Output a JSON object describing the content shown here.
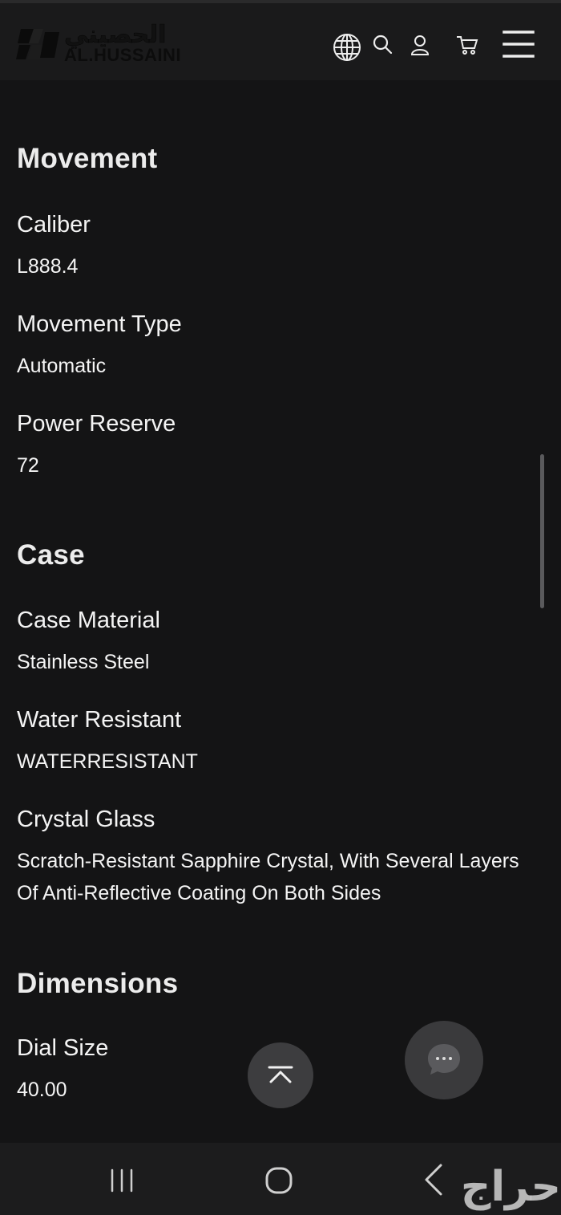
{
  "header": {
    "logo_arabic": "الحصيني",
    "logo_latin": "AL.HUSSAINI",
    "icons": [
      "globe-icon",
      "search-icon",
      "user-icon",
      "cart-icon",
      "menu-icon"
    ]
  },
  "sections": {
    "movement": {
      "title": "Movement",
      "fields": [
        {
          "label": "Caliber",
          "value": "L888.4"
        },
        {
          "label": "Movement Type",
          "value": "Automatic"
        },
        {
          "label": "Power Reserve",
          "value": "72"
        }
      ]
    },
    "case": {
      "title": "Case",
      "fields": [
        {
          "label": "Case Material",
          "value": "Stainless Steel"
        },
        {
          "label": "Water Resistant",
          "value": "WATERRESISTANT"
        },
        {
          "label": "Crystal Glass",
          "value": "Scratch-Resistant Sapphire Crystal, With Several Layers Of Anti-Reflective Coating On Both Sides"
        }
      ]
    },
    "dimensions": {
      "title": "Dimensions",
      "fields": [
        {
          "label": "Dial Size",
          "value": "40.00"
        }
      ]
    }
  },
  "floating": {
    "scroll_top_icon": "chevron-up-bar-icon",
    "chat_icon": "chat-bubble-icon"
  },
  "watermark": "حراج",
  "colors": {
    "background": "#141415",
    "header": "#1a1a1b",
    "text": "#f2f2f2",
    "button": "#3d3d3f"
  }
}
